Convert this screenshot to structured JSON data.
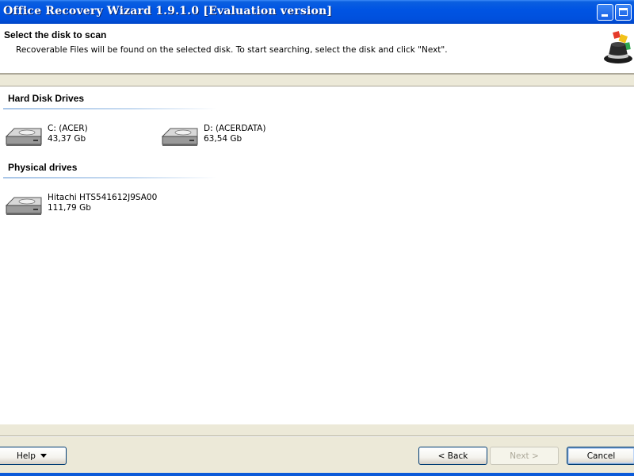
{
  "window": {
    "title": "Office Recovery Wizard 1.9.1.0 [Evaluation version]",
    "controls": {
      "minimize_icon": "minimize-icon",
      "maximize_icon": "maximize-icon"
    }
  },
  "header": {
    "title": "Select the disk to scan",
    "description": "Recoverable Files will be found on the selected disk. To start searching, select the disk and click \"Next\".",
    "logo_icon": "magic-hat-icon"
  },
  "groups": {
    "hard_disks": {
      "title": "Hard Disk Drives",
      "drives": [
        {
          "name": "C: (ACER)",
          "size": "43,37 Gb",
          "icon": "hard-drive-icon"
        },
        {
          "name": "D: (ACERDATA)",
          "size": "63,54 Gb",
          "icon": "hard-drive-icon"
        }
      ]
    },
    "physical": {
      "title": "Physical drives",
      "drives": [
        {
          "name": "Hitachi HTS541612J9SA00",
          "size": "111,79 Gb",
          "icon": "hard-drive-icon"
        }
      ]
    }
  },
  "footer": {
    "help_label": "Help",
    "back_label": "< Back",
    "next_label": "Next >",
    "cancel_label": "Cancel"
  },
  "colors": {
    "titlebar": "#0054e3",
    "dialog_face": "#ece9d8",
    "group_line": "#a9c6e8",
    "button_border": "#003c74"
  }
}
